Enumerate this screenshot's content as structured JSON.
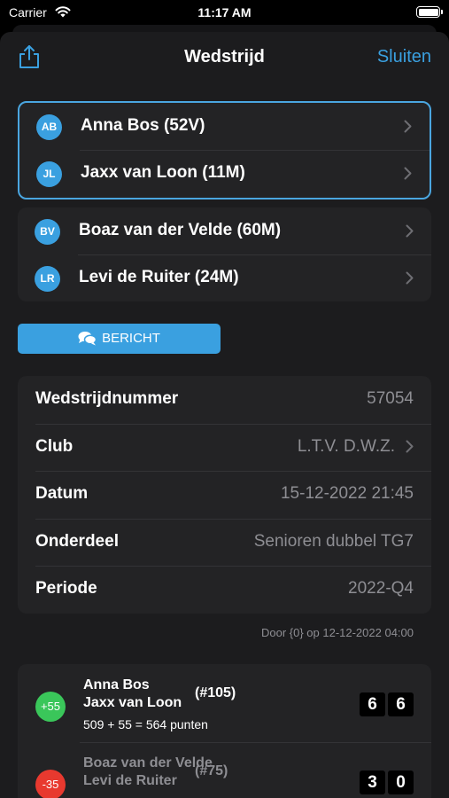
{
  "status_bar": {
    "carrier": "Carrier",
    "time": "11:17 AM"
  },
  "nav": {
    "title": "Wedstrijd",
    "close_label": "Sluiten"
  },
  "team_home": [
    {
      "initials": "AB",
      "name": "Anna Bos (52V)"
    },
    {
      "initials": "JL",
      "name": "Jaxx van Loon (11M)"
    }
  ],
  "team_away": [
    {
      "initials": "BV",
      "name": "Boaz van der Velde (60M)"
    },
    {
      "initials": "LR",
      "name": "Levi de Ruiter (24M)"
    }
  ],
  "message_button": {
    "label": "BERICHT"
  },
  "details": [
    {
      "label": "Wedstrijdnummer",
      "value": "57054"
    },
    {
      "label": "Club",
      "value": "L.T.V. D.W.Z."
    },
    {
      "label": "Datum",
      "value": "15-12-2022 21:45"
    },
    {
      "label": "Onderdeel",
      "value": "Senioren dubbel TG7"
    },
    {
      "label": "Periode",
      "value": "2022-Q4"
    }
  ],
  "footnote": "Door {0} op 12-12-2022 04:00",
  "results": [
    {
      "delta": "+55",
      "delta_color": "#3ac65a",
      "player1": "Anna Bos",
      "player2": "Jaxx van Loon",
      "rank": "(#105)",
      "points": "509 + 55 = 564 punten",
      "scores": [
        "6",
        "6"
      ]
    },
    {
      "delta": "-35",
      "delta_color": "#e8392f",
      "player1": "Boaz van der Velde",
      "player2": "Levi de Ruiter",
      "rank": "(#75)",
      "scores": [
        "3",
        "0"
      ]
    }
  ],
  "colors": {
    "accent": "#3aa0e0",
    "win": "#3ac65a",
    "loss": "#e8392f"
  }
}
